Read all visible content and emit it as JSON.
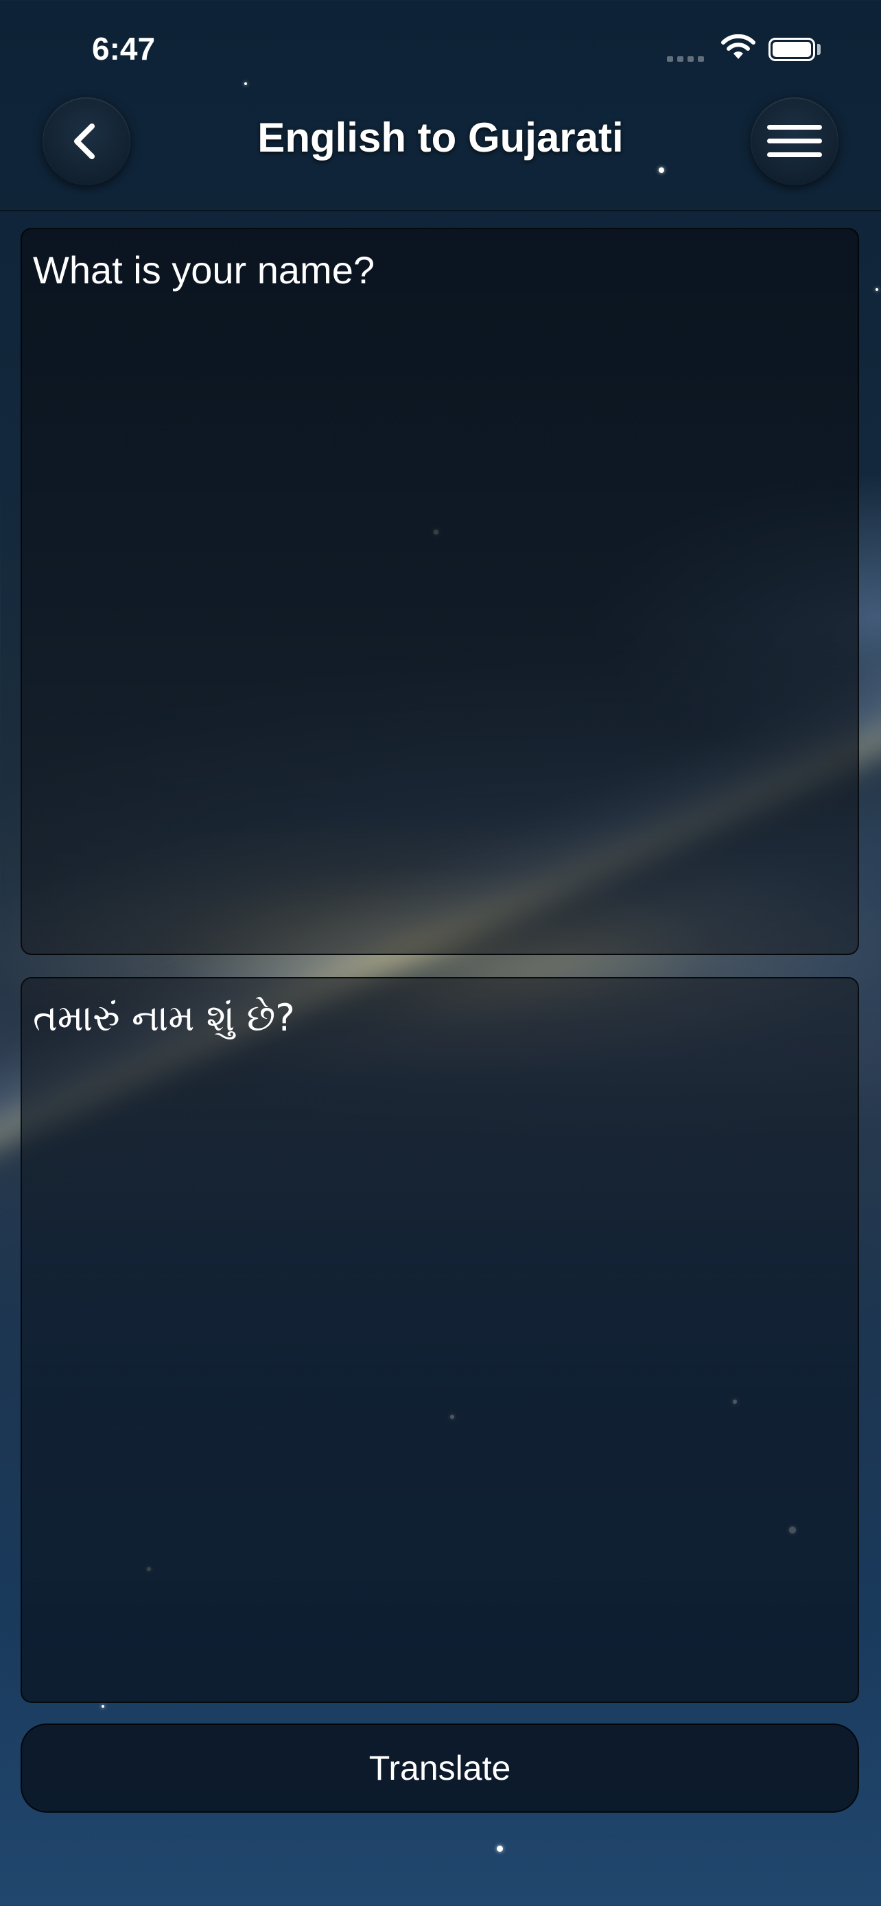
{
  "status_bar": {
    "time": "6:47"
  },
  "header": {
    "title": "English to Gujarati",
    "back_icon": "chevron-left-icon",
    "menu_icon": "hamburger-menu-icon"
  },
  "source": {
    "text": "What is your name?"
  },
  "result": {
    "text": "તમારું નામ શું છે?"
  },
  "actions": {
    "translate_label": "Translate"
  },
  "colors": {
    "text": "#ffffff",
    "panel": "#0e1722",
    "background_top": "#0d2236",
    "background_bottom": "#21476e"
  }
}
